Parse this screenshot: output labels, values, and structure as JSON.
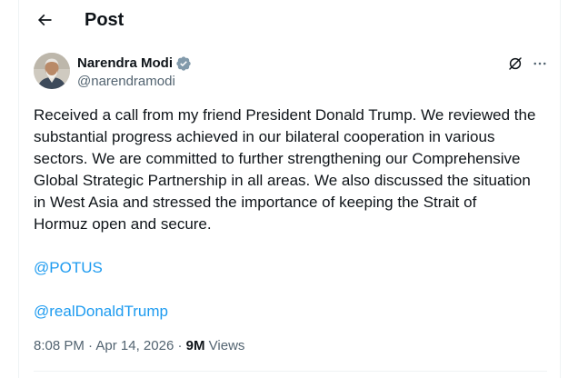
{
  "header": {
    "title": "Post",
    "back_icon": "arrow-left-icon"
  },
  "post": {
    "author": {
      "name": "Narendra Modi",
      "handle": "@narendramodi",
      "verified": true,
      "verified_color": "#829aab"
    },
    "actions": {
      "grok_icon": "grok-icon",
      "more_icon": "more-horizontal-icon"
    },
    "body_lines": [
      "Received a call from my friend President Donald Trump. We reviewed the",
      "substantial progress achieved in our bilateral cooperation in various",
      "sectors. We are committed to further strengthening our Comprehensive",
      "Global Strategic Partnership in all areas. We also discussed the situation",
      "in West Asia and stressed the importance of keeping the Strait of",
      "Hormuz open and secure."
    ],
    "mentions": [
      "@POTUS",
      "@realDonaldTrump"
    ],
    "time": "8:08 PM",
    "separator": "·",
    "date": "Apr 14, 2026",
    "views_count": "9M",
    "views_label": "Views"
  },
  "colors": {
    "text": "#0f1419",
    "secondary": "#536471",
    "link": "#1d9bf0",
    "border": "#eff3f4"
  }
}
